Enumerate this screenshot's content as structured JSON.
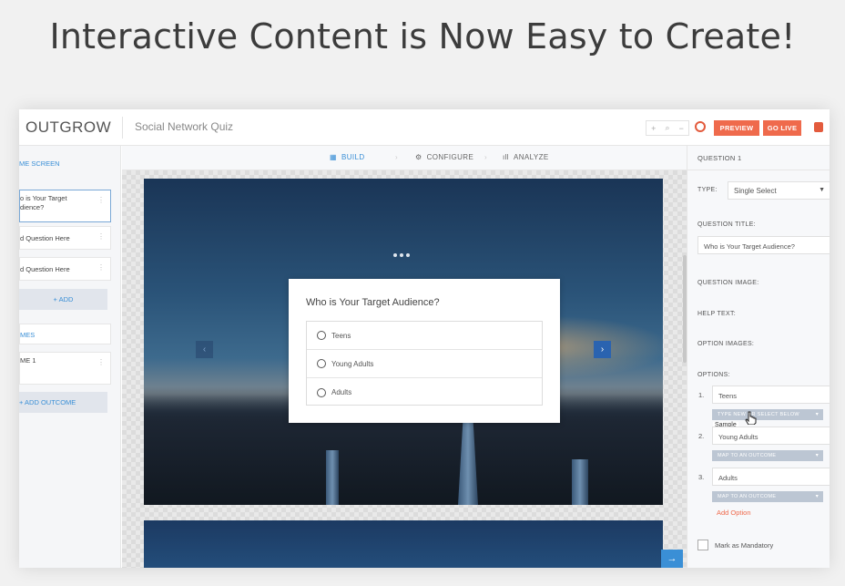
{
  "headline": "Interactive Content is Now Easy to Create!",
  "topbar": {
    "logo": "OUTGROW",
    "title": "Social Network Quiz",
    "zoom_in": "+",
    "zoom_icon": "⌕",
    "zoom_out": "−",
    "preview_label": "PREVIEW",
    "golive_label": "GO LIVE"
  },
  "sidebar": {
    "welcome_link": "ME SCREEN",
    "items": [
      {
        "label_line1": "o is Your Target",
        "label_line2": "dience?"
      },
      {
        "label_line1": "d Question Here"
      },
      {
        "label_line1": "d Question Here"
      }
    ],
    "add_label": "+ ADD",
    "outcomes_link": "MES",
    "outcome_item": "ME 1",
    "add_outcome_label": "+ ADD OUTCOME"
  },
  "tabs": [
    {
      "label": "BUILD",
      "icon": "grid-icon",
      "active": true
    },
    {
      "label": "CONFIGURE",
      "icon": "gear-icon",
      "active": false
    },
    {
      "label": "ANALYZE",
      "icon": "bar-chart-icon",
      "active": false
    }
  ],
  "quiz": {
    "question": "Who is Your Target Audience?",
    "options": [
      "Teens",
      "Young Adults",
      "Adults"
    ]
  },
  "rpanel": {
    "header": "QUESTION 1",
    "type_label": "TYPE:",
    "type_value": "Single Select",
    "question_title_label": "QUESTION TITLE:",
    "question_title_value": "Who is Your Target Audience?",
    "question_image_label": "QUESTION IMAGE:",
    "help_text_label": "HELP TEXT:",
    "option_images_label": "OPTION IMAGES:",
    "options_label": "OPTIONS:",
    "options": [
      {
        "num": "1.",
        "value": "Teens",
        "map": "TYPE NEW OR SELECT BELOW"
      },
      {
        "num": "2.",
        "value": "Young Adults",
        "map": "MAP TO AN OUTCOME"
      },
      {
        "num": "3.",
        "value": "Adults",
        "map": "MAP TO AN OUTCOME"
      }
    ],
    "tooltip": "Sample",
    "add_option": "Add Option",
    "mandatory_label": "Mark as Mandatory"
  },
  "colors": {
    "accent": "#ef6a4c",
    "link_blue": "#3a8fd6",
    "map_grey": "#bcc6d3"
  }
}
